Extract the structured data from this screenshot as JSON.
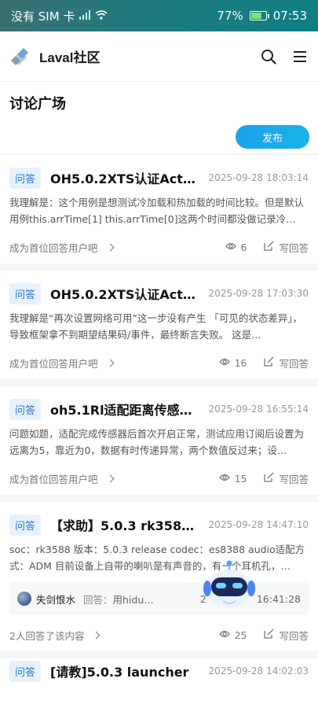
{
  "status_bar": {
    "carrier": "没有 SIM 卡",
    "battery": "77%",
    "battery_level": 0.77,
    "time": "07:53"
  },
  "header": {
    "app_title": "Laval社区"
  },
  "page": {
    "title": "讨论广场",
    "publish_label": "发布"
  },
  "posts": [
    {
      "tag": "问答",
      "title": "OH5.0.2XTS认证ActsA…",
      "time": "2025-09-28 18:03:14",
      "excerpt": "我理解是：这个用例是想测试冷加载和热加载的时间比较。但是默认用例this.arrTime[1] this.arrTime[0]这两个时间都没做记录冷…",
      "footer_link": "成为首位回答用户吧",
      "views": "6",
      "reply_label": "写回答"
    },
    {
      "tag": "问答",
      "title": "OH5.0.2XTS认证ActsA…",
      "time": "2025-09-28 17:03:30",
      "excerpt": "我理解是“再次设置网络可用”这一步没有产生 「可见的状态差异」，导致框架拿不到期望结果码/事件，最终断言失败。 这是…",
      "footer_link": "成为首位回答用户吧",
      "views": "16",
      "reply_label": "写回答"
    },
    {
      "tag": "问答",
      "title": "oh5.1Rl适配距离传感…",
      "time": "2025-09-28 16:55:14",
      "excerpt": "问题如题，适配完成传感器后首次开启正常，测试应用订阅后设置为远离为5，靠近为0，数据有时传递异常，两个数值反过来；设…",
      "footer_link": "成为首位回答用户吧",
      "views": "15",
      "reply_label": "写回答"
    },
    {
      "tag": "问答",
      "title": "【求助】5.0.3 rk3588 …",
      "time": "2025-09-28 14:47:10",
      "excerpt": "soc：rk3588 版本：5.0.3 release codec：es8388 audio适配方式：ADM 目前设备上自带的喇叭是有声音的，有一个耳机孔，…",
      "answer": {
        "user": "失剑恨水",
        "prefix": "回答：",
        "text": "用hidu…",
        "time_left": "2",
        "time": "16:41:28"
      },
      "footer_link": "2人回答了该内容",
      "views": "25",
      "reply_label": "写回答"
    }
  ],
  "partial_post": {
    "tag": "问答",
    "title": "[请教]5.0.3 launcher",
    "time": "2025-09-28 14:02:03"
  }
}
